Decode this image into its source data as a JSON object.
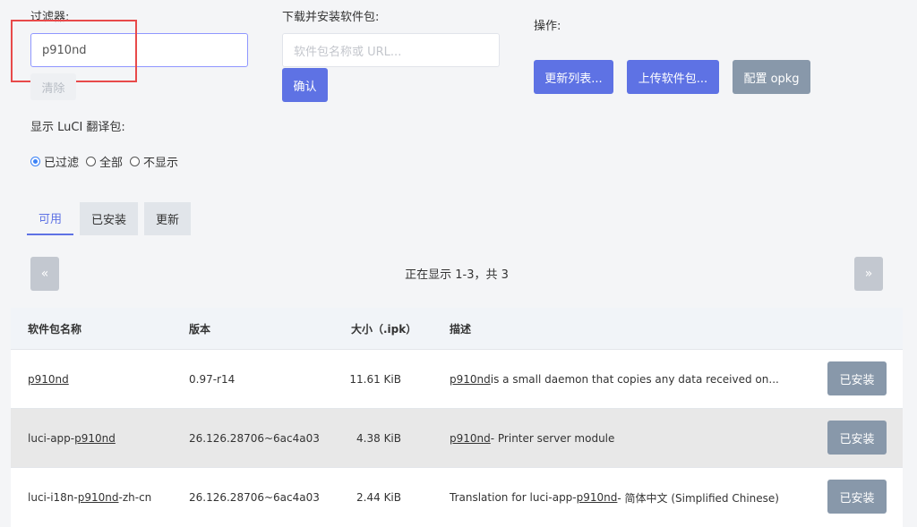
{
  "filter": {
    "label": "过滤器:",
    "value": "p910nd",
    "clear_label": "清除"
  },
  "download": {
    "label": "下载并安装软件包:",
    "placeholder": "软件包名称或 URL...",
    "confirm_label": "确认"
  },
  "actions": {
    "label": "操作:",
    "update_lists": "更新列表...",
    "upload": "上传软件包...",
    "configure": "配置 opkg"
  },
  "translations": {
    "label": "显示 LuCI 翻译包:",
    "options": [
      "已过滤",
      "全部",
      "不显示"
    ],
    "selected": "已过滤"
  },
  "tabs": [
    "可用",
    "已安装",
    "更新"
  ],
  "active_tab": "可用",
  "pager": {
    "prev": "«",
    "next": "»",
    "status": "正在显示 1-3，共 3"
  },
  "table": {
    "headers": [
      "软件包名称",
      "版本",
      "大小（.ipk）",
      "描述"
    ],
    "rows": [
      {
        "name_pre": "",
        "name_link": "p910nd",
        "name_post": "",
        "version": "0.97-r14",
        "size": "11.61 KiB",
        "desc_pre": "",
        "desc_link": "p910nd",
        "desc_post": " is a small daemon that copies any data received on...",
        "action": "已安装"
      },
      {
        "name_pre": "luci-app-",
        "name_link": "p910nd",
        "name_post": "",
        "version": "26.126.28706~6ac4a03",
        "size": "4.38 KiB",
        "desc_pre": "",
        "desc_link": "p910nd",
        "desc_post": " - Printer server module",
        "action": "已安装"
      },
      {
        "name_pre": "luci-i18n-",
        "name_link": "p910nd",
        "name_post": "-zh-cn",
        "version": "26.126.28706~6ac4a03",
        "size": "2.44 KiB",
        "desc_pre": "Translation for luci-app-",
        "desc_link": "p910nd",
        "desc_post": " - 简体中文 (Simplified Chinese)",
        "action": "已安装"
      }
    ]
  },
  "colors": {
    "primary": "#5e72e4",
    "secondary": "#8898aa",
    "highlight": "#e84a4a"
  }
}
